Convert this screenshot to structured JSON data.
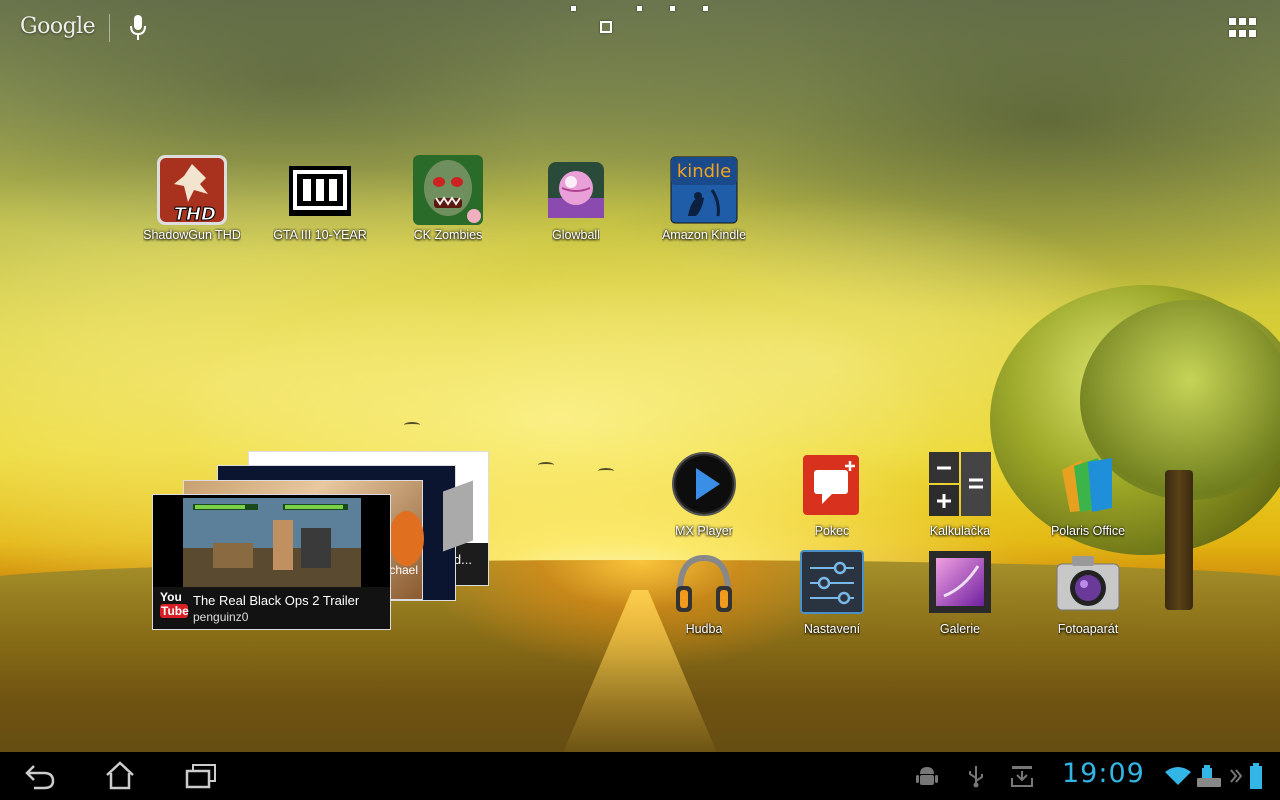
{
  "search": {
    "logo_text": "Google"
  },
  "page_indicator": {
    "count": 5,
    "current": 2
  },
  "desktop_top_row": [
    {
      "label": "ShadowGun THD",
      "icon": "shadowgun-icon"
    },
    {
      "label": "GTA III 10-YEAR",
      "icon": "gta3-icon"
    },
    {
      "label": "CK Zombies",
      "icon": "zombie-icon"
    },
    {
      "label": "Glowball",
      "icon": "glowball-icon"
    },
    {
      "label": "Amazon Kindle",
      "icon": "kindle-icon",
      "icon_text": "kindle"
    }
  ],
  "desktop_grid": [
    {
      "label": "MX Player",
      "icon": "play-icon"
    },
    {
      "label": "Pokec",
      "icon": "chat-bubble-icon"
    },
    {
      "label": "Kalkulačka",
      "icon": "calculator-icon"
    },
    {
      "label": "Polaris Office",
      "icon": "polaris-office-icon"
    },
    {
      "label": "Hudba",
      "icon": "headphones-icon"
    },
    {
      "label": "Nastavení",
      "icon": "settings-sliders-icon"
    },
    {
      "label": "Galerie",
      "icon": "gallery-icon"
    },
    {
      "label": "Fotoaparát",
      "icon": "camera-icon"
    }
  ],
  "youtube_widget": {
    "video_title": "The Real Black Ops 2 Trailer",
    "author": "penguinz0",
    "logo_top": "You",
    "logo_bottom": "Tube",
    "behind_card_text": "d...",
    "behind_card_text2": "chael"
  },
  "status_bar": {
    "time": "19:09",
    "colors": {
      "clock": "#33b5e5",
      "battery": "#33b5e5"
    }
  }
}
